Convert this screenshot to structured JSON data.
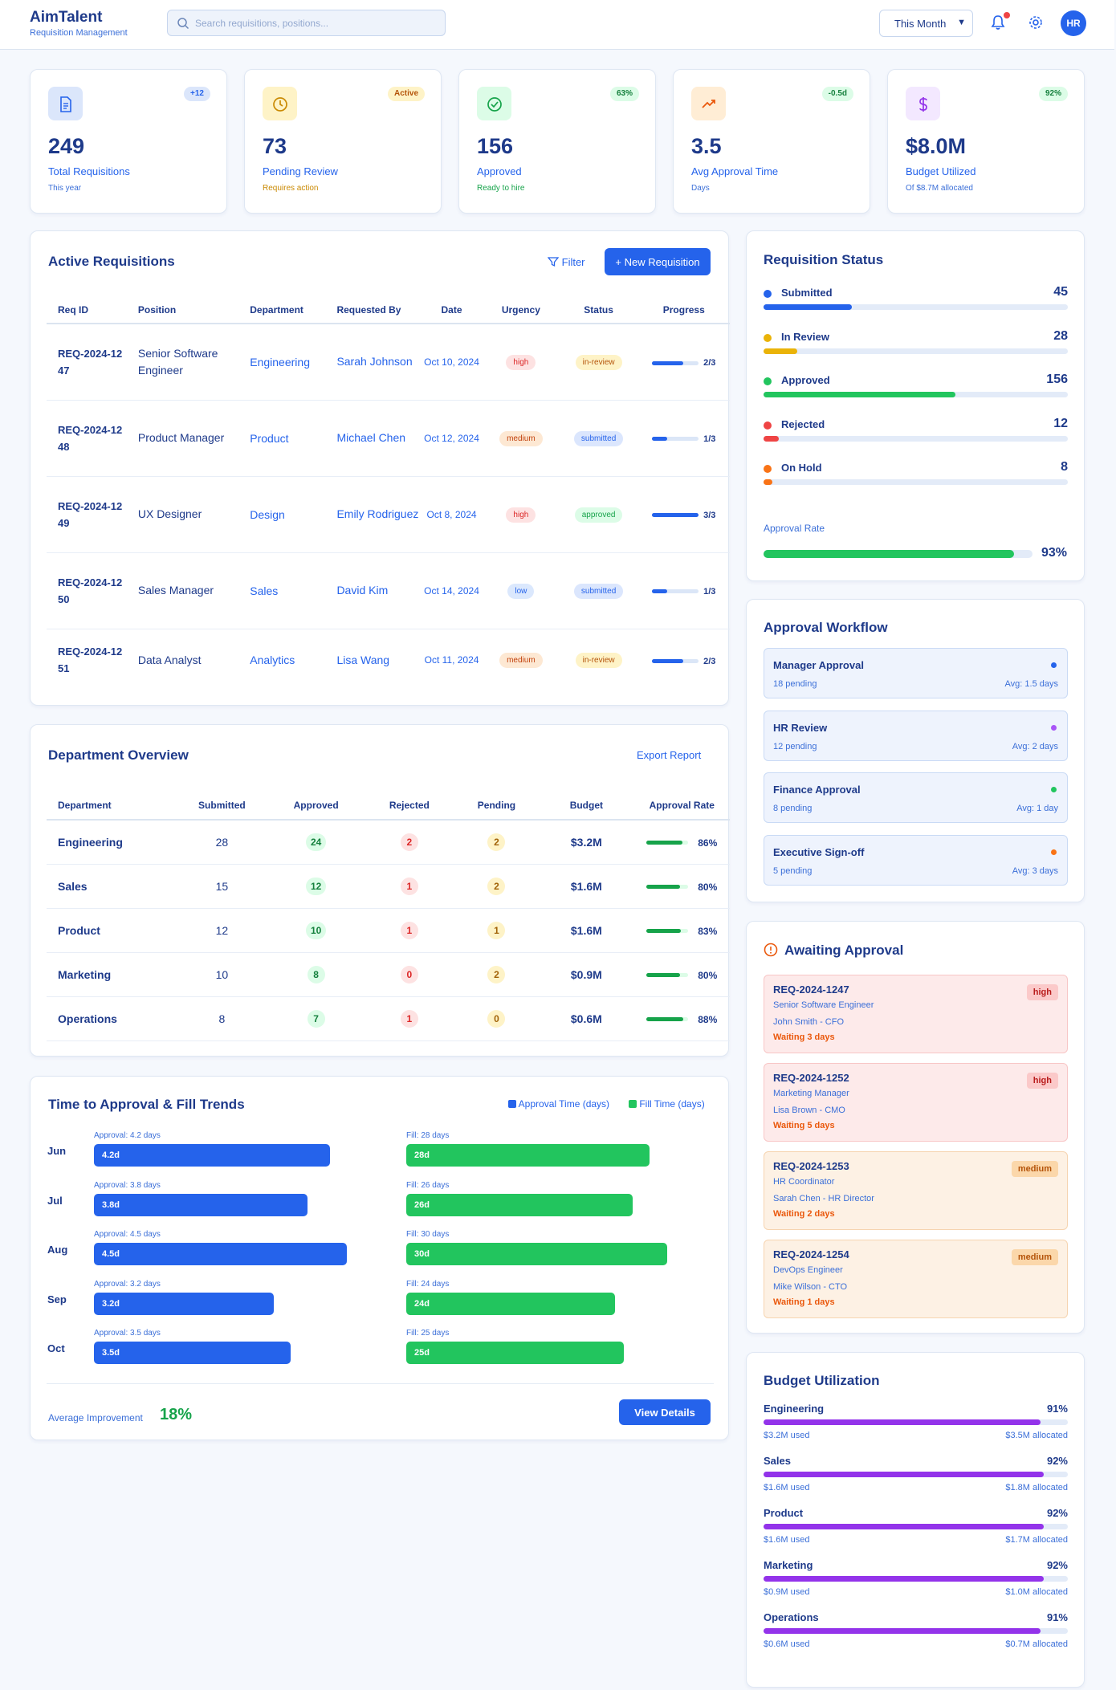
{
  "app": {
    "title": "AimTalent",
    "subtitle": "Requisition Management"
  },
  "header": {
    "search_placeholder": "Search requisitions, positions...",
    "period": "This Month",
    "avatar": "HR"
  },
  "stats": [
    {
      "value": "249",
      "label": "Total Requisitions",
      "sub": "This year",
      "badge": "+12",
      "icon": "document-icon",
      "color": "#2563eb"
    },
    {
      "value": "73",
      "label": "Pending Review",
      "sub": "Requires action",
      "badge": "Active",
      "icon": "clock-icon",
      "color": "#ca8a04"
    },
    {
      "value": "156",
      "label": "Approved",
      "sub": "Ready to hire",
      "badge": "63%",
      "icon": "check-circle-icon",
      "color": "#16a34a"
    },
    {
      "value": "3.5",
      "label": "Avg Approval Time",
      "sub": "Days",
      "badge": "-0.5d",
      "icon": "trending-up-icon",
      "color": "#ea580c"
    },
    {
      "value": "$8.0M",
      "label": "Budget Utilized",
      "sub": "Of $8.7M allocated",
      "badge": "92%",
      "icon": "dollar-icon",
      "color": "#9333ea"
    }
  ],
  "active_requisitions": {
    "title": "Active Requisitions",
    "filter_label": "Filter",
    "new_label": "+ New Requisition",
    "columns": [
      "Req ID",
      "Position",
      "Department",
      "Requested By",
      "Date",
      "Urgency",
      "Status",
      "Progress"
    ],
    "rows": [
      {
        "id": "REQ-2024-1247",
        "position": "Senior Software Engineer",
        "department": "Engineering",
        "requested_by": "Sarah Johnson",
        "date": "Oct 10, 2024",
        "urgency": "high",
        "status": "in-review",
        "progress": "2/3",
        "progress_value": 0.667
      },
      {
        "id": "REQ-2024-1248",
        "position": "Product Manager",
        "department": "Product",
        "requested_by": "Michael Chen",
        "date": "Oct 12, 2024",
        "urgency": "medium",
        "status": "submitted",
        "progress": "1/3",
        "progress_value": 0.333
      },
      {
        "id": "REQ-2024-1249",
        "position": "UX Designer",
        "department": "Design",
        "requested_by": "Emily Rodriguez",
        "date": "Oct 8, 2024",
        "urgency": "high",
        "status": "approved",
        "progress": "3/3",
        "progress_value": 1.0
      },
      {
        "id": "REQ-2024-1250",
        "position": "Sales Manager",
        "department": "Sales",
        "requested_by": "David Kim",
        "date": "Oct 14, 2024",
        "urgency": "low",
        "status": "submitted",
        "progress": "1/3",
        "progress_value": 0.333
      },
      {
        "id": "REQ-2024-1251",
        "position": "Data Analyst",
        "department": "Analytics",
        "requested_by": "Lisa Wang",
        "date": "Oct 11, 2024",
        "urgency": "medium",
        "status": "in-review",
        "progress": "2/3",
        "progress_value": 0.667
      }
    ]
  },
  "department_overview": {
    "title": "Department Overview",
    "export_label": "Export Report",
    "columns": [
      "Department",
      "Submitted",
      "Approved",
      "Rejected",
      "Pending",
      "Budget",
      "Approval Rate"
    ],
    "rows": [
      {
        "department": "Engineering",
        "submitted": "28",
        "approved": "24",
        "rejected": "2",
        "pending": "2",
        "budget": "$3.2M",
        "rate": "86%",
        "rate_value": 0.86
      },
      {
        "department": "Sales",
        "submitted": "15",
        "approved": "12",
        "rejected": "1",
        "pending": "2",
        "budget": "$1.6M",
        "rate": "80%",
        "rate_value": 0.8
      },
      {
        "department": "Product",
        "submitted": "12",
        "approved": "10",
        "rejected": "1",
        "pending": "1",
        "budget": "$1.6M",
        "rate": "83%",
        "rate_value": 0.83
      },
      {
        "department": "Marketing",
        "submitted": "10",
        "approved": "8",
        "rejected": "0",
        "pending": "2",
        "budget": "$0.9M",
        "rate": "80%",
        "rate_value": 0.8
      },
      {
        "department": "Operations",
        "submitted": "8",
        "approved": "7",
        "rejected": "1",
        "pending": "0",
        "budget": "$0.6M",
        "rate": "88%",
        "rate_value": 0.88
      }
    ]
  },
  "trends": {
    "title": "Time to Approval & Fill Trends",
    "legend_approval": "Approval Time (days)",
    "legend_fill": "Fill Time (days)",
    "approval_color": "#2563eb",
    "fill_color": "#22c55e",
    "rows": [
      {
        "month": "Jun",
        "approval_caption": "Approval: 4.2 days",
        "approval_label": "4.2d",
        "approval": 4.2,
        "fill_caption": "Fill: 28 days",
        "fill_label": "28d",
        "fill": 28
      },
      {
        "month": "Jul",
        "approval_caption": "Approval: 3.8 days",
        "approval_label": "3.8d",
        "approval": 3.8,
        "fill_caption": "Fill: 26 days",
        "fill_label": "26d",
        "fill": 26
      },
      {
        "month": "Aug",
        "approval_caption": "Approval: 4.5 days",
        "approval_label": "4.5d",
        "approval": 4.5,
        "fill_caption": "Fill: 30 days",
        "fill_label": "30d",
        "fill": 30
      },
      {
        "month": "Sep",
        "approval_caption": "Approval: 3.2 days",
        "approval_label": "3.2d",
        "approval": 3.2,
        "fill_caption": "Fill: 24 days",
        "fill_label": "24d",
        "fill": 24
      },
      {
        "month": "Oct",
        "approval_caption": "Approval: 3.5 days",
        "approval_label": "3.5d",
        "approval": 3.5,
        "fill_caption": "Fill: 25 days",
        "fill_label": "25d",
        "fill": 25
      }
    ],
    "improvement_label": "Average Improvement",
    "improvement_value": "18%",
    "details_label": "View Details"
  },
  "requisition_status": {
    "title": "Requisition Status",
    "items": [
      {
        "label": "Submitted",
        "value": "45",
        "fraction": 0.29,
        "color": "#2563eb"
      },
      {
        "label": "In Review",
        "value": "28",
        "fraction": 0.11,
        "color": "#eab308"
      },
      {
        "label": "Approved",
        "value": "156",
        "fraction": 0.63,
        "color": "#22c55e"
      },
      {
        "label": "Rejected",
        "value": "12",
        "fraction": 0.05,
        "color": "#ef4444"
      },
      {
        "label": "On Hold",
        "value": "8",
        "fraction": 0.03,
        "color": "#f97316"
      }
    ],
    "rate_label": "Approval Rate",
    "rate_value": "93%",
    "rate_fraction": 0.93
  },
  "workflow": {
    "title": "Approval Workflow",
    "steps": [
      {
        "name": "Manager Approval",
        "pending": "18 pending",
        "avg": "Avg: 1.5 days",
        "color": "#2563eb"
      },
      {
        "name": "HR Review",
        "pending": "12 pending",
        "avg": "Avg: 2 days",
        "color": "#a855f7"
      },
      {
        "name": "Finance Approval",
        "pending": "8 pending",
        "avg": "Avg: 1 day",
        "color": "#22c55e"
      },
      {
        "name": "Executive Sign-off",
        "pending": "5 pending",
        "avg": "Avg: 3 days",
        "color": "#f97316"
      }
    ]
  },
  "awaiting": {
    "title": "Awaiting Approval",
    "items": [
      {
        "id": "REQ-2024-1247",
        "position": "Senior Software Engineer",
        "approver": "John Smith - CFO",
        "waiting": "Waiting 3 days",
        "urgency": "high"
      },
      {
        "id": "REQ-2024-1252",
        "position": "Marketing Manager",
        "approver": "Lisa Brown - CMO",
        "waiting": "Waiting 5 days",
        "urgency": "high"
      },
      {
        "id": "REQ-2024-1253",
        "position": "HR Coordinator",
        "approver": "Sarah Chen - HR Director",
        "waiting": "Waiting 2 days",
        "urgency": "medium"
      },
      {
        "id": "REQ-2024-1254",
        "position": "DevOps Engineer",
        "approver": "Mike Wilson - CTO",
        "waiting": "Waiting 1 days",
        "urgency": "medium"
      }
    ]
  },
  "budget_utilization": {
    "title": "Budget Utilization",
    "items": [
      {
        "name": "Engineering",
        "pct": "91%",
        "fraction": 0.91,
        "used": "$3.2M used",
        "allocated": "$3.5M allocated"
      },
      {
        "name": "Sales",
        "pct": "92%",
        "fraction": 0.92,
        "used": "$1.6M used",
        "allocated": "$1.8M allocated"
      },
      {
        "name": "Product",
        "pct": "92%",
        "fraction": 0.92,
        "used": "$1.6M used",
        "allocated": "$1.7M allocated"
      },
      {
        "name": "Marketing",
        "pct": "92%",
        "fraction": 0.92,
        "used": "$0.9M used",
        "allocated": "$1.0M allocated"
      },
      {
        "name": "Operations",
        "pct": "91%",
        "fraction": 0.91,
        "used": "$0.6M used",
        "allocated": "$0.7M allocated"
      }
    ]
  }
}
